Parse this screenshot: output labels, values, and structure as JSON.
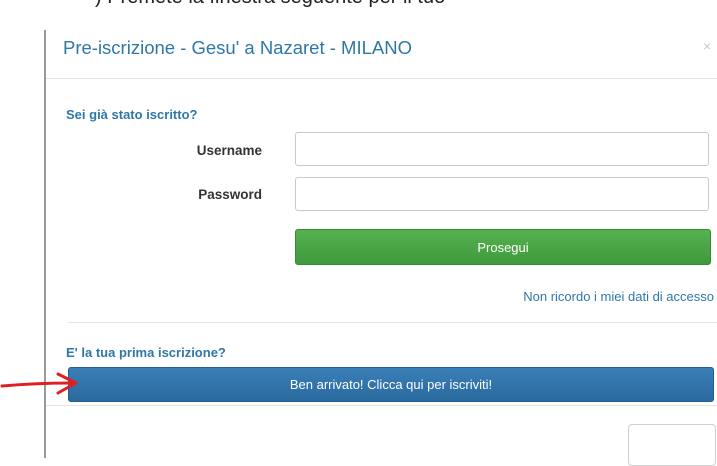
{
  "document": {
    "instruction_text": ") Premete la finestra seguente per il tuo"
  },
  "modal": {
    "title": "Pre-iscrizione - Gesu' a Nazaret - MILANO",
    "close_label": "×"
  },
  "login": {
    "heading": "Sei già stato iscritto?",
    "username_label": "Username",
    "username_value": "",
    "password_label": "Password",
    "password_value": "",
    "submit_label": "Prosegui",
    "forgot_link": "Non ricordo i miei dati di accesso"
  },
  "register": {
    "heading": "E' la tua prima iscrizione?",
    "button_label": "Ben arrivato! Clicca qui per iscriviti!"
  },
  "colors": {
    "accent_blue": "#2f77a8",
    "submit_green": "#4aa645",
    "register_blue": "#2f74ad",
    "arrow_red": "#e02020"
  }
}
